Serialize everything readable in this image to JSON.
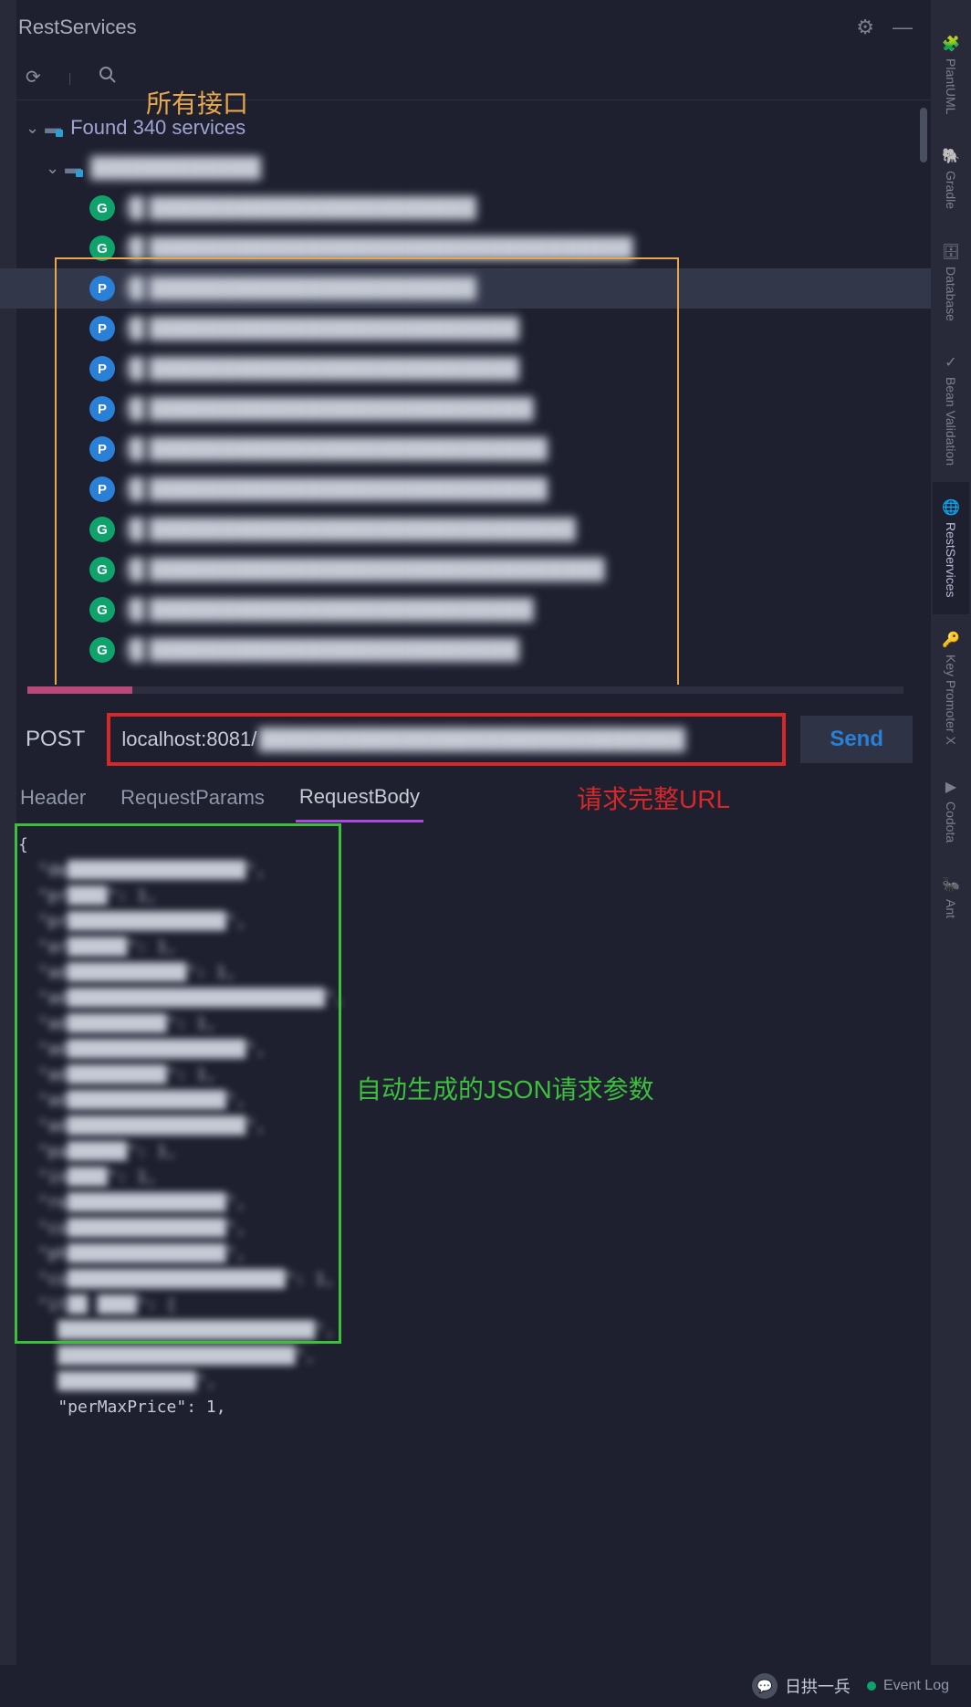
{
  "titlebar": {
    "title": "RestServices"
  },
  "annotations": {
    "top": "所有接口",
    "url": "请求完整URL",
    "json": "自动生成的JSON请求参数"
  },
  "tree": {
    "root_label": "Found 340 services",
    "module_label": "████████████",
    "endpoints": [
      {
        "method": "G",
        "path": "/█ ███████████████████████"
      },
      {
        "method": "G",
        "path": "/█ ██████████████████████████████████"
      },
      {
        "method": "P",
        "path": "/█ ███████████████████████",
        "selected": true
      },
      {
        "method": "P",
        "path": "/█ ██████████████████████████"
      },
      {
        "method": "P",
        "path": "/█ ██████████████████████████"
      },
      {
        "method": "P",
        "path": "/█ ███████████████████████████"
      },
      {
        "method": "P",
        "path": "/█ ████████████████████████████"
      },
      {
        "method": "P",
        "path": "/█ ████████████████████████████"
      },
      {
        "method": "G",
        "path": "/█ ██████████████████████████████"
      },
      {
        "method": "G",
        "path": "/█ ████████████████████████████████"
      },
      {
        "method": "G",
        "path": "/█ ███████████████████████████"
      },
      {
        "method": "G",
        "path": "/█ ██████████████████████████"
      }
    ]
  },
  "request": {
    "method": "POST",
    "url_prefix": "localhost:8081/",
    "url_rest": "██████████████████████████████",
    "send": "Send"
  },
  "tabs": {
    "items": [
      "Header",
      "RequestParams",
      "RequestBody"
    ],
    "active": 2
  },
  "json_body": {
    "lines": [
      "{",
      "  \"de██████████████████\",",
      "  \"pr████\": 1,",
      "  \"pr████████████████\",",
      "  \"ar██████\": 1,",
      "  \"ad████████████\": 1,",
      "  \"ad██████████████████████████\",",
      "  \"ad██████████\": 1,",
      "  \"ad██████████████████\",",
      "  \"ad██████████\": 1,",
      "  \"ad████████████████\",",
      "  \"ad██████████████████\",",
      "  \"pa██████\": 1,",
      "  \"in████\": 1,",
      "  \"re████████████████\",",
      "  \"co████████████████\",",
      "  \"ph████████████████\",",
      "  \"co██████████████████████\": 1,",
      "  \"it██ ████\": [",
      "    ██████████████████████████\",",
      "    ████████████████████████\",",
      "    ██████████████\",",
      "    \"perMaxPrice\": 1,"
    ]
  },
  "sidebar": {
    "items": [
      {
        "icon": "🧩",
        "label": "PlantUML"
      },
      {
        "icon": "🐘",
        "label": "Gradle"
      },
      {
        "icon": "🗄",
        "label": "Database"
      },
      {
        "icon": "✓",
        "label": "Bean Validation"
      },
      {
        "icon": "🌐",
        "label": "RestServices",
        "active": true
      },
      {
        "icon": "🔑",
        "label": "Key Promoter X"
      },
      {
        "icon": "▶",
        "label": "Codota"
      },
      {
        "icon": "🐜",
        "label": "Ant"
      }
    ]
  },
  "bottom": {
    "wechat": "日拱一兵",
    "event_log": "Event Log"
  }
}
